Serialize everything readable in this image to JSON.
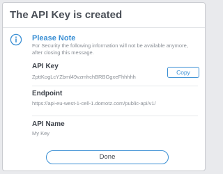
{
  "dialog": {
    "title": "The API Key is created",
    "note": {
      "icon": "info-icon",
      "title": "Please Note",
      "text": "For Security the following information will not be available anymore, after closing this message."
    },
    "api_key": {
      "label": "API Key",
      "value": "ZpttKogLcYZbml49vzmhchBRBGgxeFhhhhh",
      "copy_label": "Copy"
    },
    "endpoint": {
      "label": "Endpoint",
      "value": "https://api-eu-west-1-cell-1.domotz.com/public-api/v1/"
    },
    "api_name": {
      "label": "API Name",
      "value": "My Key"
    },
    "done_label": "Done"
  },
  "colors": {
    "accent": "#3a8fd4",
    "title_text": "#4a4f57",
    "body_text": "#3d424a",
    "muted_text": "#8a8f96",
    "backdrop": "#e9eaed"
  }
}
